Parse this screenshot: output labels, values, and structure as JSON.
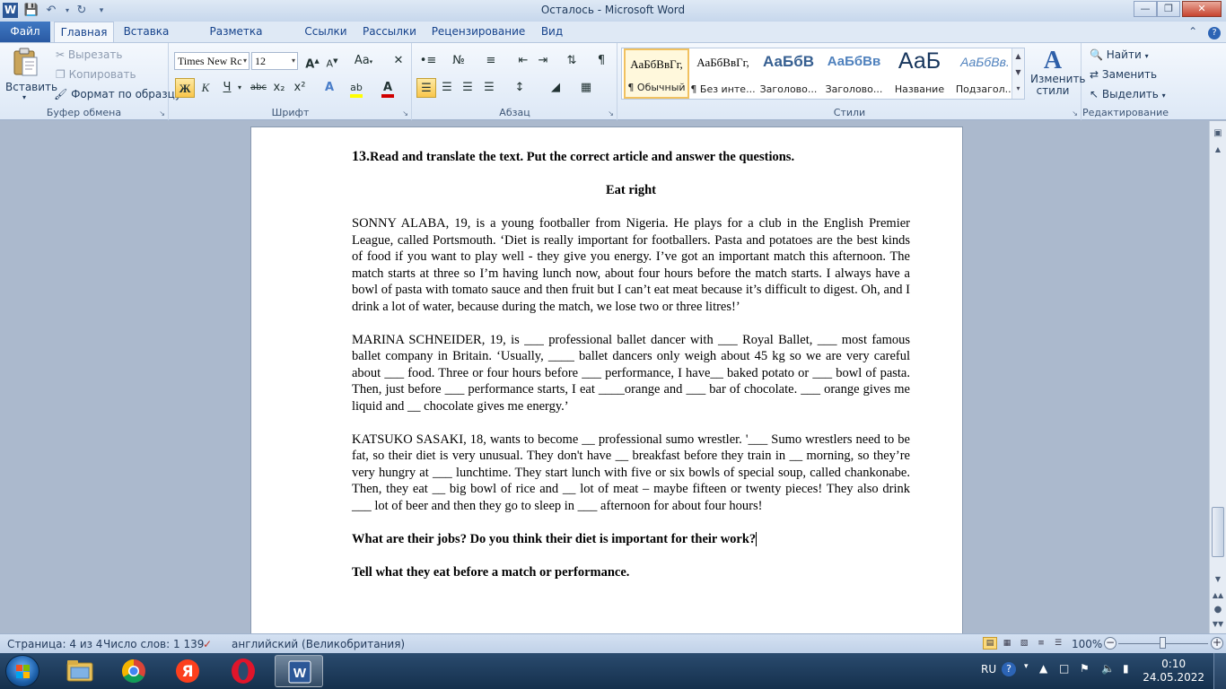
{
  "window": {
    "title": "Осталось  -  Microsoft Word",
    "app_icon": "W"
  },
  "tabs": {
    "file": "Файл",
    "items": [
      "Главная",
      "Вставка",
      "Разметка страницы",
      "Ссылки",
      "Рассылки",
      "Рецензирование",
      "Вид"
    ],
    "active": "Главная"
  },
  "ribbon": {
    "clipboard": {
      "label": "Буфер обмена",
      "paste": "Вставить",
      "cut": "Вырезать",
      "copy": "Копировать",
      "format_painter": "Формат по образцу"
    },
    "font": {
      "label": "Шрифт",
      "font_name": "Times New Rc",
      "font_size": "12",
      "bold_label": "Ж",
      "italic_label": "К",
      "underline_label": "Ч",
      "strike_label": "abc",
      "sub_label": "x₂",
      "sup_label": "x²",
      "grow_label": "A",
      "shrink_label": "A",
      "case_label": "Aa",
      "highlight_color": "#ffff00",
      "font_color": "#d00000"
    },
    "paragraph": {
      "label": "Абзац",
      "pilcrow": "¶"
    },
    "styles": {
      "label": "Стили",
      "items": [
        {
          "preview": "АаБбВвГг,",
          "name": "¶ Обычный"
        },
        {
          "preview": "АаБбВвГг,",
          "name": "¶ Без инте..."
        },
        {
          "preview": "АаБбВ",
          "name": "Заголово..."
        },
        {
          "preview": "АаБбВв",
          "name": "Заголово..."
        },
        {
          "preview": "АаБ",
          "name": "Название"
        },
        {
          "preview": "АаБбВв.",
          "name": "Подзагол..."
        }
      ],
      "change_styles": "Изменить стили"
    },
    "editing": {
      "label": "Редактирование",
      "find": "Найти",
      "replace": "Заменить",
      "select": "Выделить"
    }
  },
  "document": {
    "task_number": "13.",
    "task_heading": "Read and translate the text. Put the correct article and answer the questions.",
    "title": "Eat right",
    "paragraphs": [
      "SONNY ALABA, 19, is a young footballer from Nigeria. He plays for a club in the English Premier League, called Portsmouth. ‘Diet is really important for footballers. Pasta and potatoes are the best kinds of food if you want to play well - they give you energy. I’ve got an important match this afternoon. The match starts at three so I’m having lunch now, about four hours before the match starts. I always have a bowl of pasta with tomato sauce and then fruit but I can’t eat meat because it’s difficult to digest. Oh, and I drink a lot of water, because during the match, we lose two or three litres!’",
      "MARINA SCHNEIDER, 19, is ___ professional ballet dancer with ___ Royal Ballet, ___ most famous ballet company in Britain. ‘Usually, ____ ballet dancers only weigh about 45 kg so we are very careful about ___ food. Three or four hours before ___ performance, I have__ baked potato or ___ bowl of pasta. Then, just before ___ performance starts, I eat ____orange and ___ bar of chocolate. ___ orange gives me liquid and __ chocolate gives me energy.’",
      "KATSUKO SASAKI, 18, wants to become __ professional sumo wrestler. '___ Sumo wrestlers need to be fat, so their diet is very unusual. They don't have __ breakfast before they train in __ morning, so they’re very hungry at ___ lunchtime. They start lunch with five or six bowls of special soup, called chankonabe. Then, they eat __ big bowl of rice and __ lot of meat – maybe fifteen or twenty pieces! They also drink ___ lot of beer and then they go to sleep in ___ afternoon for about four hours!"
    ],
    "question_1": "What are their jobs? Do you think their diet is important for their work?",
    "question_2": "Tell what they eat before a match or performance."
  },
  "statusbar": {
    "page": "Страница: 4 из 4",
    "words": "Число слов: 1 139",
    "language": "английский (Великобритания)",
    "zoom": "100%",
    "zoom_value": 100
  },
  "taskbar": {
    "apps": [
      "windows-explorer",
      "google-chrome",
      "yandex-browser",
      "opera",
      "microsoft-word"
    ],
    "active_app": "microsoft-word",
    "lang": "RU",
    "time": "0:10",
    "date": "24.05.2022"
  }
}
